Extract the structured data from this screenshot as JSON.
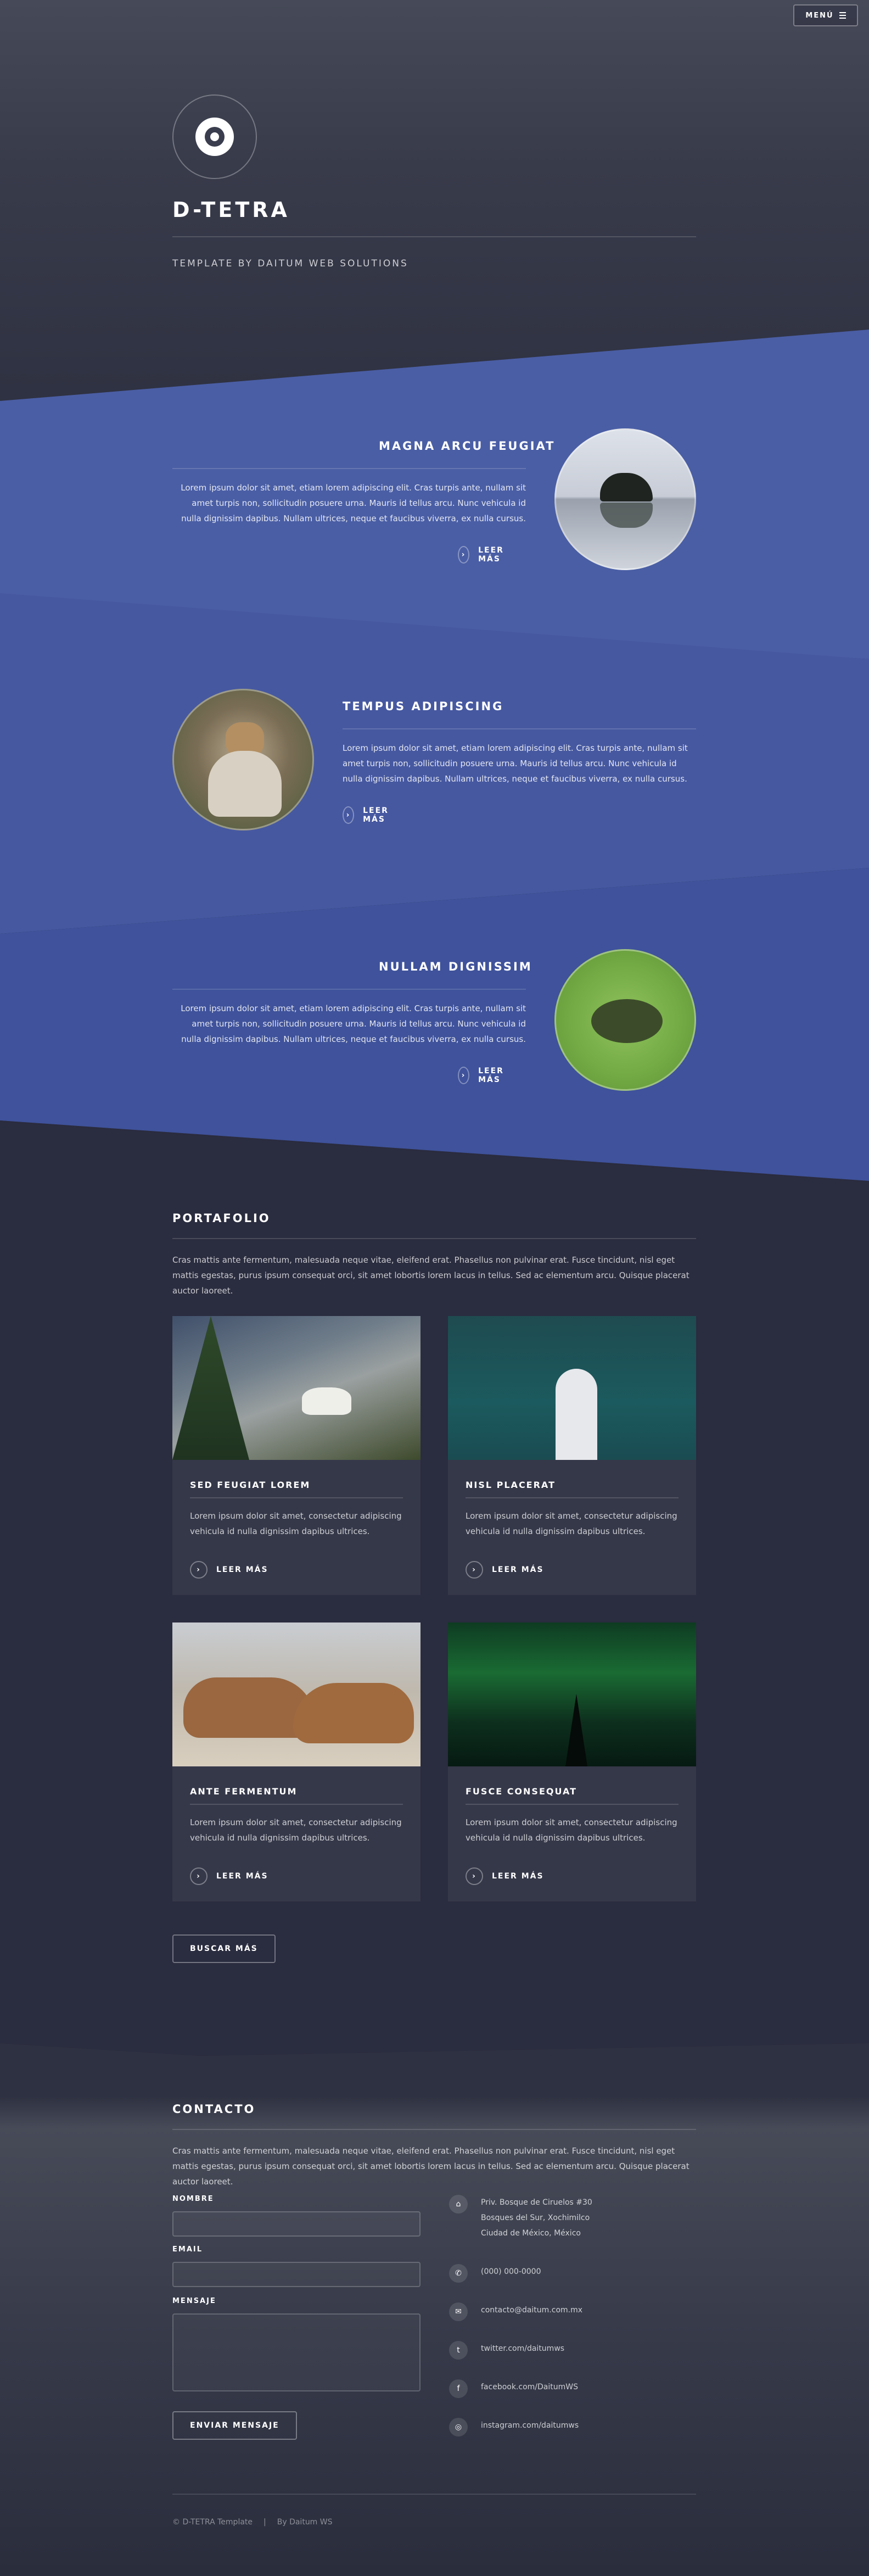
{
  "header": {
    "menu_label": "MENÚ",
    "site_title": "D-TETRA",
    "site_subtitle": "TEMPLATE BY DAITUM WEB SOLUTIONS"
  },
  "spotlights": [
    {
      "title": "MAGNA ARCU FEUGIAT",
      "text": "Lorem ipsum dolor sit amet, etiam lorem adipiscing elit. Cras turpis ante, nullam sit amet turpis non, sollicitudin posuere urna. Mauris id tellus arcu. Nunc vehicula id nulla dignissim dapibus. Nullam ultrices, neque et faucibus viverra, ex nulla cursus.",
      "more_label": "LEER MÁS"
    },
    {
      "title": "TEMPUS ADIPISCING",
      "text": "Lorem ipsum dolor sit amet, etiam lorem adipiscing elit. Cras turpis ante, nullam sit amet turpis non, sollicitudin posuere urna. Mauris id tellus arcu. Nunc vehicula id nulla dignissim dapibus. Nullam ultrices, neque et faucibus viverra, ex nulla cursus.",
      "more_label": "LEER MÁS"
    },
    {
      "title": "NULLAM DIGNISSIM",
      "text": "Lorem ipsum dolor sit amet, etiam lorem adipiscing elit. Cras turpis ante, nullam sit amet turpis non, sollicitudin posuere urna. Mauris id tellus arcu. Nunc vehicula id nulla dignissim dapibus. Nullam ultrices, neque et faucibus viverra, ex nulla cursus.",
      "more_label": "LEER MÁS"
    }
  ],
  "portfolio": {
    "title": "PORTAFOLIO",
    "intro": "Cras mattis ante fermentum, malesuada neque vitae, eleifend erat. Phasellus non pulvinar erat. Fusce tincidunt, nisl eget mattis egestas, purus ipsum consequat orci, sit amet lobortis lorem lacus in tellus. Sed ac elementum arcu. Quisque placerat auctor laoreet.",
    "cards": [
      {
        "title": "SED FEUGIAT LOREM",
        "text": "Lorem ipsum dolor sit amet, consectetur adipiscing vehicula id nulla dignissim dapibus ultrices.",
        "more_label": "LEER MÁS"
      },
      {
        "title": "NISL PLACERAT",
        "text": "Lorem ipsum dolor sit amet, consectetur adipiscing vehicula id nulla dignissim dapibus ultrices.",
        "more_label": "LEER MÁS"
      },
      {
        "title": "ANTE FERMENTUM",
        "text": "Lorem ipsum dolor sit amet, consectetur adipiscing vehicula id nulla dignissim dapibus ultrices.",
        "more_label": "LEER MÁS"
      },
      {
        "title": "FUSCE CONSEQUAT",
        "text": "Lorem ipsum dolor sit amet, consectetur adipiscing vehicula id nulla dignissim dapibus ultrices.",
        "more_label": "LEER MÁS"
      }
    ],
    "more_button": "BUSCAR MÁS"
  },
  "contact": {
    "title": "CONTACTO",
    "intro": "Cras mattis ante fermentum, malesuada neque vitae, eleifend erat. Phasellus non pulvinar erat. Fusce tincidunt, nisl eget mattis egestas, purus ipsum consequat orci, sit amet lobortis lorem lacus in tellus. Sed ac elementum arcu. Quisque placerat auctor laoreet.",
    "labels": {
      "name": "NOMBRE",
      "email": "EMAIL",
      "message": "MENSAJE"
    },
    "values": {
      "name": "",
      "email": "",
      "message": ""
    },
    "submit": "ENVIAR MENSAJE",
    "address": [
      "Priv. Bosque de Ciruelos #30",
      "Bosques del Sur, Xochimilco",
      "Ciudad de México, México"
    ],
    "phone": "(000) 000-0000",
    "email": "contacto@daitum.com.mx",
    "twitter": "twitter.com/daitumws",
    "facebook": "facebook.com/DaitumWS",
    "instagram": "instagram.com/daitumws"
  },
  "footer": {
    "copyright": "© D-TETRA Template",
    "separator": "|",
    "credit": "By Daitum WS"
  },
  "icons": {
    "menu": "menu-bars-icon",
    "arrow": "arrow-right-icon",
    "home": "home-icon",
    "phone": "phone-icon",
    "envelope": "envelope-icon",
    "twitter": "twitter-icon",
    "facebook": "facebook-icon",
    "instagram": "instagram-icon"
  },
  "colors": {
    "background": "#2e3141",
    "spotlight_blue": "#4a5ea5",
    "card": "#353849",
    "text": "#ffffff"
  }
}
